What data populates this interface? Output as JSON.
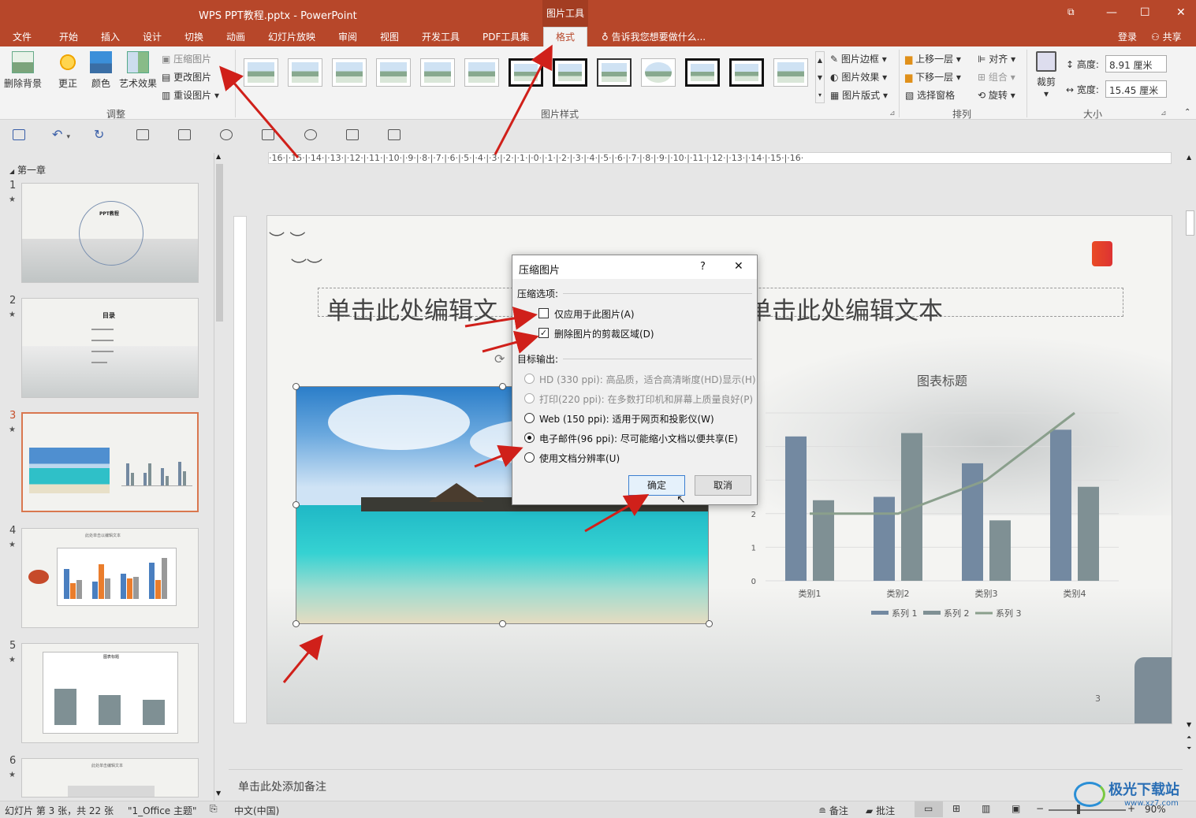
{
  "window": {
    "title": "WPS PPT教程.pptx - PowerPoint",
    "context_tool": "图片工具",
    "controls": [
      "☐",
      "—",
      "☐",
      "✕"
    ]
  },
  "menu": {
    "tabs": [
      "文件",
      "开始",
      "插入",
      "设计",
      "切换",
      "动画",
      "幻灯片放映",
      "审阅",
      "视图",
      "开发工具",
      "PDF工具集",
      "格式"
    ],
    "active": "格式",
    "tell_me": "告诉我您想要做什么...",
    "login": "登录",
    "share": "共享"
  },
  "ribbon": {
    "adjust": {
      "remove_bg": "删除背景",
      "correct": "更正",
      "color": "颜色",
      "artistic": "艺术效果",
      "compress": "压缩图片",
      "change": "更改图片",
      "reset": "重设图片",
      "label": "调整"
    },
    "styles": {
      "label": "图片样式",
      "border": "图片边框",
      "effect": "图片效果",
      "layout": "图片版式"
    },
    "arrange": {
      "label": "排列",
      "forward": "上移一层",
      "backward": "下移一层",
      "pane": "选择窗格",
      "align": "对齐",
      "group": "组合",
      "rotate": "旋转"
    },
    "size": {
      "label": "大小",
      "crop": "裁剪",
      "height_label": "高度:",
      "height_value": "8.91 厘米",
      "width_label": "宽度:",
      "width_value": "15.45 厘米"
    }
  },
  "ruler_text": "·16·|·15·|·14·|·13·|·12·|·11·|·10·|·9·|·8·|·7·|·6·|·5·|·4·|·3·|·2·|·1·|·0·|·1·|·2·|·3·|·4·|·5·|·6·|·7·|·8·|·9·|·10·|·11·|·12·|·13·|·14·|·15·|·16·",
  "thumbnails": {
    "section": "第一章",
    "slides": [
      {
        "num": "1",
        "text": "PPT教程"
      },
      {
        "num": "2",
        "text": "目录"
      },
      {
        "num": "3",
        "text": ""
      },
      {
        "num": "4",
        "text": "此处单击以编辑文本"
      },
      {
        "num": "5",
        "text": "图表标题"
      },
      {
        "num": "6",
        "text": "此处单击编辑文本"
      }
    ]
  },
  "slide": {
    "title_placeholder_left": "单击此处编辑文",
    "title_placeholder_right": "单击此处编辑文本",
    "page_number": "3"
  },
  "chart_data": {
    "type": "bar",
    "title": "图表标题",
    "categories": [
      "类别1",
      "类别2",
      "类别3",
      "类别4"
    ],
    "series": [
      {
        "name": "系列 1",
        "type": "bar",
        "values": [
          4.3,
          2.5,
          3.5,
          4.5
        ],
        "color": "#7389a1"
      },
      {
        "name": "系列 2",
        "type": "bar",
        "values": [
          2.4,
          4.4,
          1.8,
          2.8
        ],
        "color": "#7f9094"
      },
      {
        "name": "系列 3",
        "type": "line",
        "values": [
          2,
          2,
          3,
          5
        ],
        "color": "#8a9f8c"
      }
    ],
    "y_ticks": [
      "0",
      "1",
      "2"
    ],
    "ylim": [
      0,
      5
    ],
    "legend": "bottom"
  },
  "dialog": {
    "title": "压缩图片",
    "help": "?",
    "close": "✕",
    "section_compress": "压缩选项:",
    "opt_only_this": "仅应用于此图片(A)",
    "opt_only_this_checked": false,
    "opt_delete_crop": "删除图片的剪裁区域(D)",
    "opt_delete_crop_checked": true,
    "section_target": "目标输出:",
    "targets": [
      {
        "label": "HD (330 ppi): 高品质，适合高清晰度(HD)显示(H)",
        "enabled": false,
        "selected": false
      },
      {
        "label": "打印(220 ppi): 在多数打印机和屏幕上质量良好(P)",
        "enabled": false,
        "selected": false
      },
      {
        "label": "Web (150 ppi): 适用于网页和投影仪(W)",
        "enabled": true,
        "selected": false
      },
      {
        "label": "电子邮件(96 ppi): 尽可能缩小文档以便共享(E)",
        "enabled": true,
        "selected": true
      },
      {
        "label": "使用文档分辨率(U)",
        "enabled": true,
        "selected": false
      }
    ],
    "ok": "确定",
    "cancel": "取消"
  },
  "notes_placeholder": "单击此处添加备注",
  "status": {
    "slide_info": "幻灯片 第 3 张，共 22 张",
    "theme": "\"1_Office 主题\"",
    "language": "中文(中国)",
    "notes": "备注",
    "comments": "批注",
    "zoom": "90%"
  },
  "watermark": "极光下载站",
  "watermark_url": "www.xz7.com"
}
